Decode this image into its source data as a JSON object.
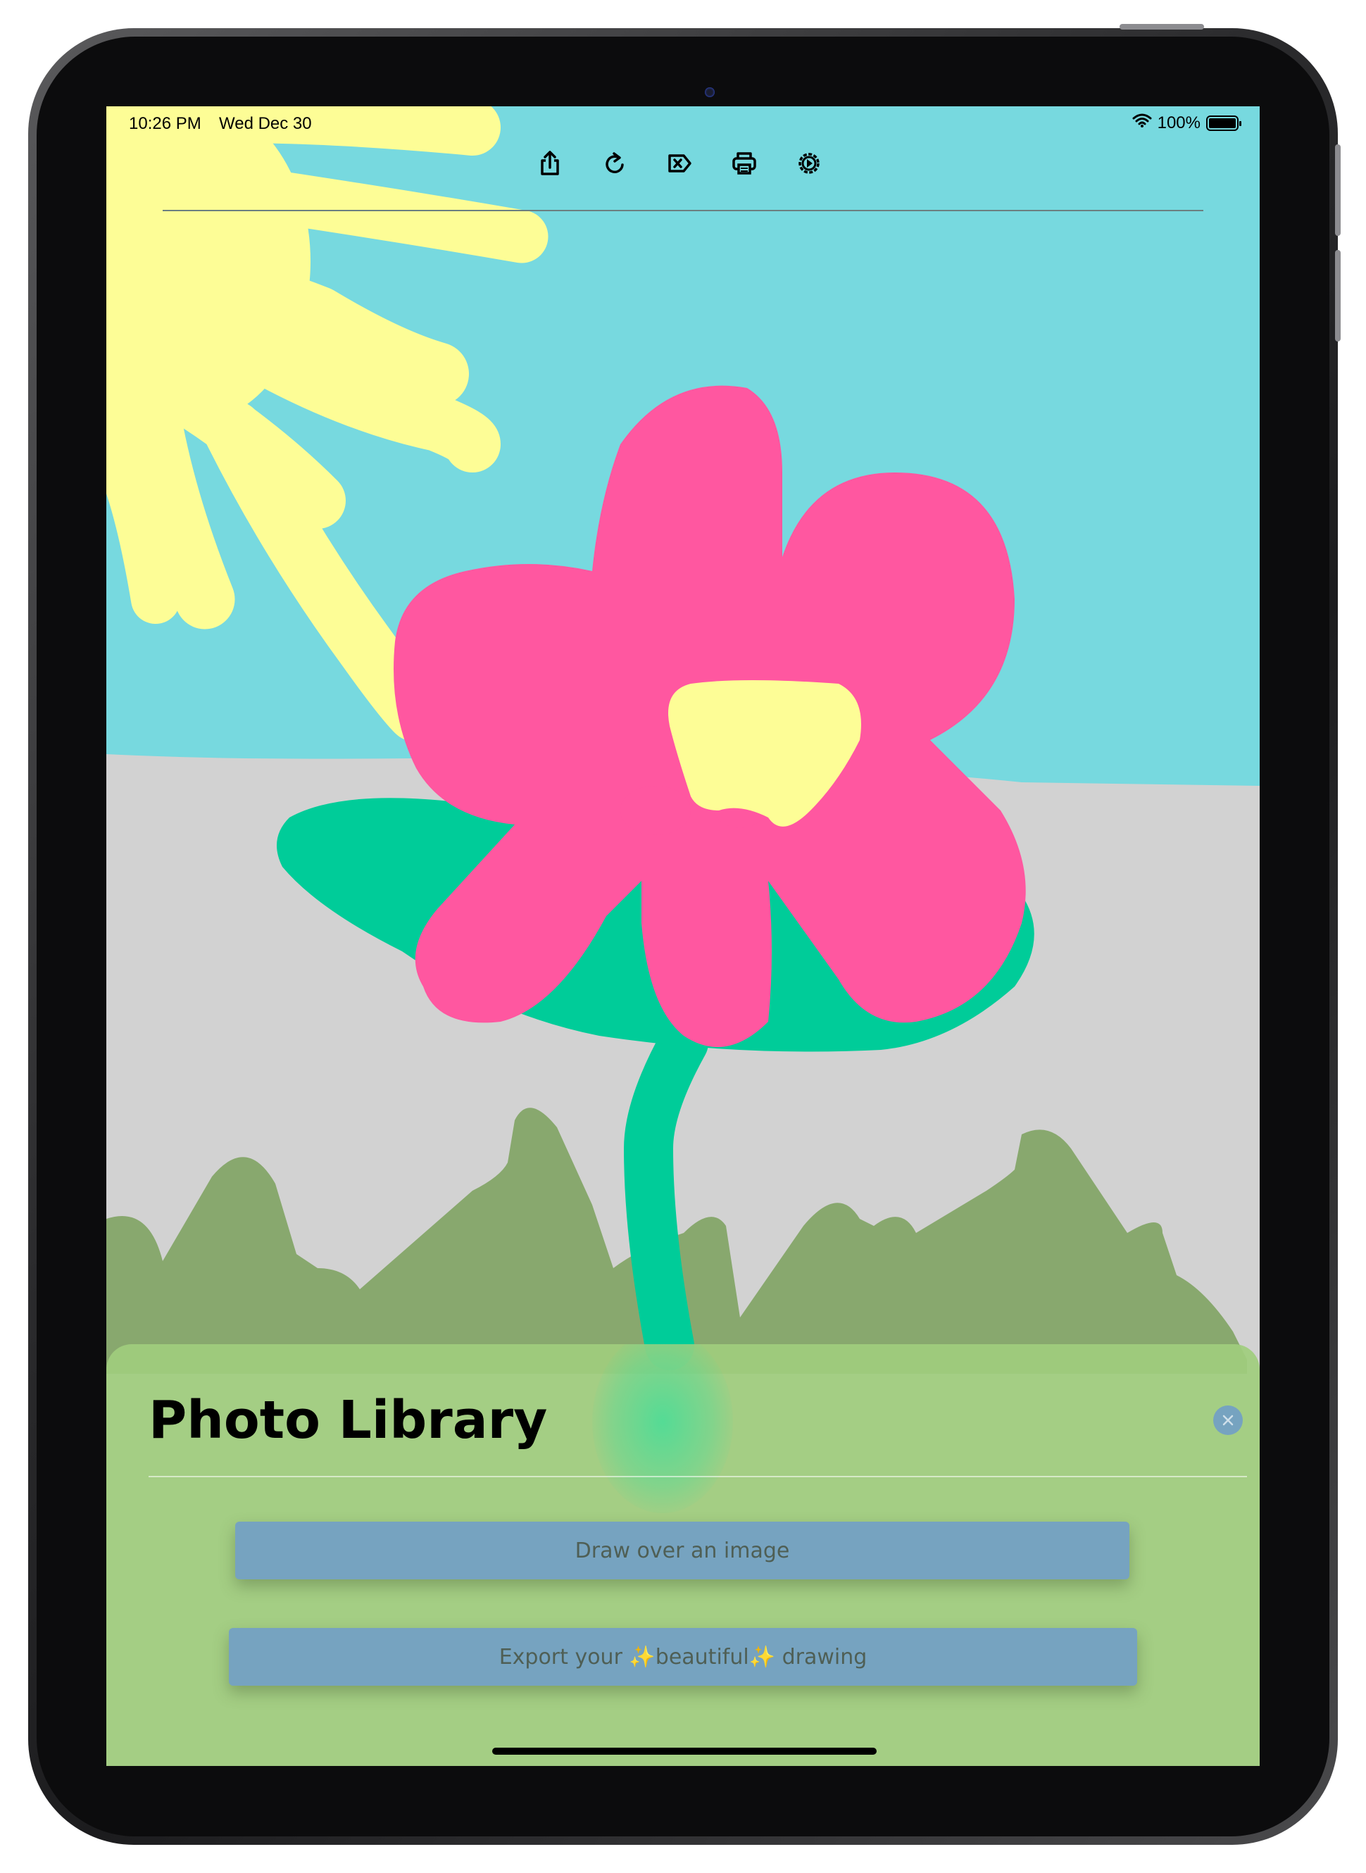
{
  "status_bar": {
    "time": "10:26 PM",
    "date": "Wed Dec 30",
    "battery_text": "100%",
    "battery_level": 1.0
  },
  "toolbar": {
    "buttons": [
      {
        "name": "share-icon"
      },
      {
        "name": "redo-icon"
      },
      {
        "name": "clear-icon"
      },
      {
        "name": "print-icon"
      },
      {
        "name": "settings-icon"
      }
    ]
  },
  "sheet": {
    "title": "Photo Library",
    "draw_button_label": "Draw over an image",
    "export_button_label": "Export your ✨beautiful✨ drawing"
  },
  "colors": {
    "sky": "#77d9df",
    "sun": "#fdfd96",
    "ground": "#d2d2d2",
    "grass": "#88a86e",
    "stem": "#00cc99",
    "petal": "#ff57a0",
    "sheet_background": "#a0cd7d",
    "sheet_button": "#76a3c0"
  }
}
